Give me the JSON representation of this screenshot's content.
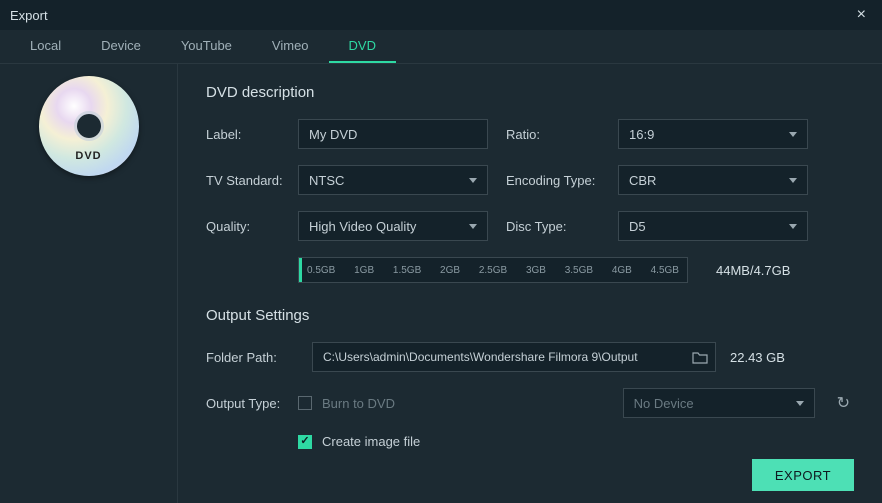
{
  "window": {
    "title": "Export"
  },
  "tabs": {
    "local": "Local",
    "device": "Device",
    "youtube": "YouTube",
    "vimeo": "Vimeo",
    "dvd": "DVD"
  },
  "sidebar": {
    "disc_text": "DVD"
  },
  "dvd": {
    "heading": "DVD description",
    "label_lbl": "Label:",
    "label_value": "My DVD",
    "ratio_lbl": "Ratio:",
    "ratio_value": "16:9",
    "tvstd_lbl": "TV Standard:",
    "tvstd_value": "NTSC",
    "enc_lbl": "Encoding Type:",
    "enc_value": "CBR",
    "quality_lbl": "Quality:",
    "quality_value": "High Video Quality",
    "disctype_lbl": "Disc Type:",
    "disctype_value": "D5",
    "gauge_ticks": [
      "0.5GB",
      "1GB",
      "1.5GB",
      "2GB",
      "2.5GB",
      "3GB",
      "3.5GB",
      "4GB",
      "4.5GB"
    ],
    "size_text": "44MB/4.7GB"
  },
  "output": {
    "heading": "Output Settings",
    "folder_lbl": "Folder Path:",
    "folder_value": "C:\\Users\\admin\\Documents\\Wondershare Filmora 9\\Output",
    "free_space": "22.43 GB",
    "output_type_lbl": "Output Type:",
    "burn_label": "Burn to DVD",
    "device_value": "No Device",
    "create_image_label": "Create image file"
  },
  "actions": {
    "export": "EXPORT"
  }
}
